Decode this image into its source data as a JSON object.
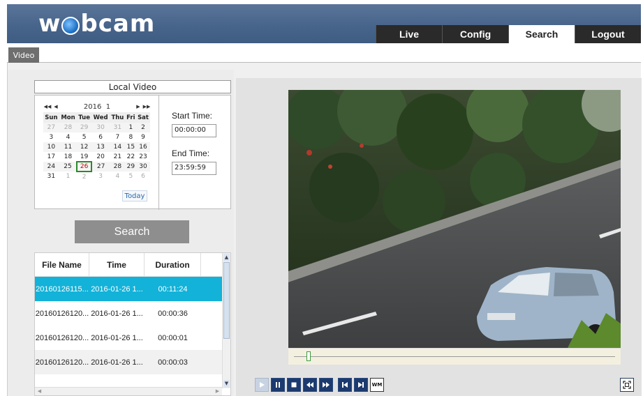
{
  "header": {
    "logo_text_left": "w",
    "logo_text_right": "bcam",
    "nav": [
      {
        "label": "Live",
        "active": false
      },
      {
        "label": "Config",
        "active": false
      },
      {
        "label": "Search",
        "active": true
      },
      {
        "label": "Logout",
        "active": false
      }
    ]
  },
  "subtabs": {
    "video": "Video"
  },
  "search_panel": {
    "title": "Local Video",
    "calendar": {
      "year": "2016",
      "month": "1",
      "nav_prev_year": "◀◀",
      "nav_prev_month": "◀",
      "nav_next_month": "▶",
      "nav_next_year": "▶▶",
      "weekdays": [
        "Sun",
        "Mon",
        "Tue",
        "Wed",
        "Thu",
        "Fri",
        "Sat"
      ],
      "weeks": [
        [
          {
            "d": "27",
            "o": true
          },
          {
            "d": "28",
            "o": true
          },
          {
            "d": "29",
            "o": true
          },
          {
            "d": "30",
            "o": true
          },
          {
            "d": "31",
            "o": true
          },
          {
            "d": "1"
          },
          {
            "d": "2"
          }
        ],
        [
          {
            "d": "3"
          },
          {
            "d": "4"
          },
          {
            "d": "5"
          },
          {
            "d": "6"
          },
          {
            "d": "7"
          },
          {
            "d": "8"
          },
          {
            "d": "9"
          }
        ],
        [
          {
            "d": "10"
          },
          {
            "d": "11"
          },
          {
            "d": "12"
          },
          {
            "d": "13"
          },
          {
            "d": "14"
          },
          {
            "d": "15"
          },
          {
            "d": "16"
          }
        ],
        [
          {
            "d": "17"
          },
          {
            "d": "18"
          },
          {
            "d": "19"
          },
          {
            "d": "20"
          },
          {
            "d": "21"
          },
          {
            "d": "22"
          },
          {
            "d": "23"
          }
        ],
        [
          {
            "d": "24"
          },
          {
            "d": "25"
          },
          {
            "d": "26",
            "sel": true
          },
          {
            "d": "27"
          },
          {
            "d": "28"
          },
          {
            "d": "29"
          },
          {
            "d": "30"
          }
        ],
        [
          {
            "d": "31"
          },
          {
            "d": "1",
            "o": true
          },
          {
            "d": "2",
            "o": true
          },
          {
            "d": "3",
            "o": true
          },
          {
            "d": "4",
            "o": true
          },
          {
            "d": "5",
            "o": true
          },
          {
            "d": "6",
            "o": true
          }
        ]
      ],
      "today_label": "Today"
    },
    "start_time_label": "Start Time:",
    "start_time_value": "00:00:00",
    "end_time_label": "End Time:",
    "end_time_value": "23:59:59",
    "search_button": "Search"
  },
  "file_table": {
    "columns": [
      "File Name",
      "Time",
      "Duration"
    ],
    "rows": [
      {
        "name": "20160126115...",
        "time": "2016-01-26 1...",
        "duration": "00:11:24",
        "selected": true
      },
      {
        "name": "20160126120...",
        "time": "2016-01-26 1...",
        "duration": "00:00:36"
      },
      {
        "name": "20160126120...",
        "time": "2016-01-26 1...",
        "duration": "00:00:01"
      },
      {
        "name": "20160126120...",
        "time": "2016-01-26 1...",
        "duration": "00:00:03"
      }
    ]
  },
  "player": {
    "progress_fraction": 0.04,
    "controls": [
      "play-icon",
      "pause-icon",
      "stop-icon",
      "rewind-icon",
      "fast-forward-icon",
      "previous-frame-icon",
      "next-frame-icon",
      "watermark-icon"
    ],
    "watermark_label": "WM",
    "fullscreen_icon": "fullscreen-icon"
  },
  "colors": {
    "header": "#46638a",
    "selected_row": "#13b2d8",
    "control_blue": "#1c3a6e"
  }
}
